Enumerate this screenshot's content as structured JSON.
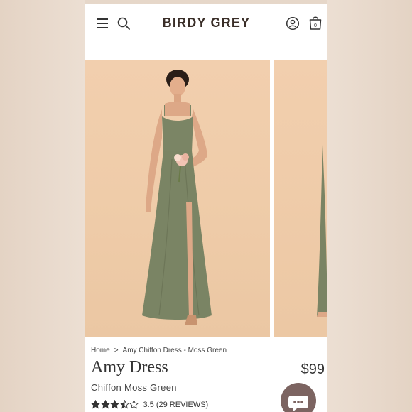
{
  "header": {
    "logo": "BIRDY GREY",
    "cart_count": "0"
  },
  "breadcrumb": {
    "home": "Home",
    "separator": ">",
    "current": "Amy Chiffon Dress - Moss Green"
  },
  "product": {
    "name": "Amy Dress",
    "variant": "Chiffon Moss Green",
    "price": "$99",
    "rating_value": 3.5,
    "rating_max": 5,
    "reviews_label": "3.5 (29 REVIEWS)"
  },
  "colors": {
    "dress": "#7b8565",
    "backdrop": "#efcca9",
    "brand_text": "#3a2e28",
    "chat_button": "#7c6461"
  },
  "icons": [
    "menu-icon",
    "search-icon",
    "account-icon",
    "shopping-bag-icon",
    "star-icon",
    "chat-icon"
  ]
}
